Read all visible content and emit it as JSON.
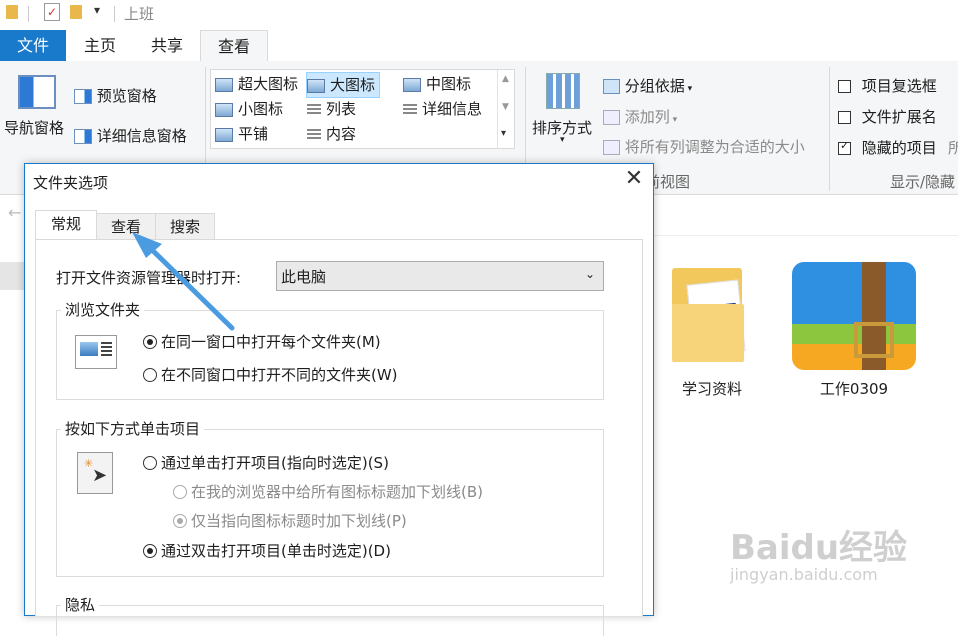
{
  "window": {
    "title": "上班"
  },
  "ribbon_tabs": [
    "文件",
    "主页",
    "共享",
    "查看"
  ],
  "ribbon": {
    "nav_pane": "导航窗格",
    "preview_pane": "预览窗格",
    "details_pane": "详细信息窗格",
    "layout": {
      "items": [
        "超大图标",
        "大图标",
        "中图标",
        "小图标",
        "列表",
        "详细信息",
        "平铺",
        "内容"
      ],
      "selected": "大图标"
    },
    "sort_by": "排序方式",
    "group_by": "分组依据",
    "add_columns": "添加列",
    "size_columns": "将所有列调整为合适的大小",
    "current_view_label": "当前视图",
    "item_checkboxes": "项目复选框",
    "file_extensions": "文件扩展名",
    "hidden_items": "隐藏的项目",
    "hidden_items_checked": true,
    "show_hide_label": "显示/隐藏",
    "partial_char": "所"
  },
  "files": [
    {
      "name": "学习资料",
      "type": "folder"
    },
    {
      "name": "工作0309",
      "type": "archive"
    }
  ],
  "dialog": {
    "title": "文件夹选项",
    "close_glyph": "✕",
    "tabs": [
      "常规",
      "查看",
      "搜索"
    ],
    "active_tab": "常规",
    "open_with_label": "打开文件资源管理器时打开:",
    "open_with_value": "此电脑",
    "browse_group": {
      "legend": "浏览文件夹",
      "options": [
        "在同一窗口中打开每个文件夹(M)",
        "在不同窗口中打开不同的文件夹(W)"
      ],
      "selected": 0
    },
    "click_group": {
      "legend": "按如下方式单击项目",
      "single_click": "通过单击打开项目(指向时选定)(S)",
      "underline_all": "在我的浏览器中给所有图标标题加下划线(B)",
      "underline_hover": "仅当指向图标标题时加下划线(P)",
      "double_click": "通过双击打开项目(单击时选定)(D)",
      "selected": "double_click"
    },
    "privacy_legend": "隐私"
  },
  "watermark": {
    "brand": "Baidu经验",
    "site": "jingyan.baidu.com"
  },
  "colors": {
    "accent": "#1979ca",
    "arrow": "#4a9be0"
  }
}
